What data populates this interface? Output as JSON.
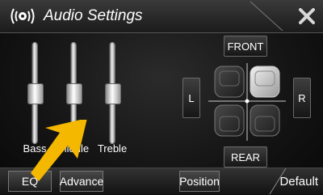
{
  "header": {
    "title": "Audio Settings",
    "icon": "speaker-icon",
    "close_icon": "close-icon"
  },
  "sliders": [
    {
      "label": "Bass",
      "level": 0.5
    },
    {
      "label": "Middle",
      "level": 0.5
    },
    {
      "label": "Treble",
      "level": 0.5
    }
  ],
  "balance": {
    "front_label": "FRONT",
    "rear_label": "REAR",
    "left_label": "L",
    "right_label": "R",
    "highlighted_seat": "front-right"
  },
  "tabs": {
    "eq": "EQ",
    "advance": "Advance",
    "position": "Position",
    "default": "Default"
  },
  "annotation": {
    "arrow_color": "#F5B800"
  }
}
